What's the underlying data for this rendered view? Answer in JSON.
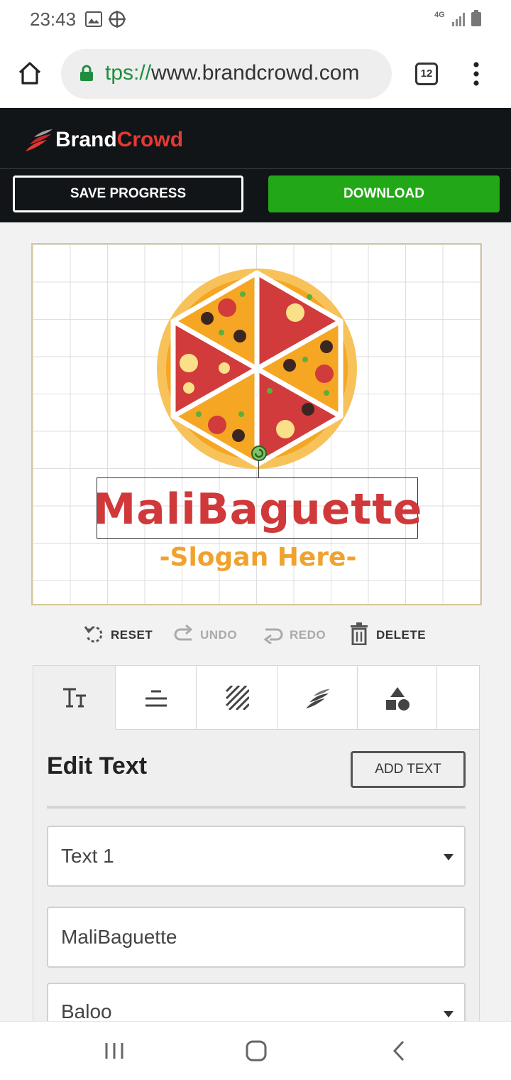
{
  "status_bar": {
    "time": "23:43",
    "network": "4G"
  },
  "browser": {
    "url_scheme": "tps://",
    "url_host": "www.brandcrowd.com",
    "tab_count": "12"
  },
  "header": {
    "brand_part1": "Brand",
    "brand_part2": "Crowd",
    "brand_color1": "#ffffff",
    "brand_color2": "#e53935"
  },
  "actions": {
    "save_label": "SAVE PROGRESS",
    "download_label": "DOWNLOAD"
  },
  "logo": {
    "name": "MaliBaguette",
    "slogan": "-Slogan Here-",
    "name_color": "#d0383a",
    "slogan_color": "#f0a22e"
  },
  "editor_tools": {
    "reset": "RESET",
    "undo": "UNDO",
    "redo": "REDO",
    "delete": "DELETE"
  },
  "tabs": [
    {
      "icon": "text-style-icon"
    },
    {
      "icon": "align-icon"
    },
    {
      "icon": "pattern-icon"
    },
    {
      "icon": "brand-icon"
    },
    {
      "icon": "shapes-icon"
    }
  ],
  "panel": {
    "title": "Edit Text",
    "add_text_label": "ADD TEXT",
    "text_select_value": "Text 1",
    "text_input_value": "MaliBaguette",
    "font_select_value": "Baloo"
  }
}
